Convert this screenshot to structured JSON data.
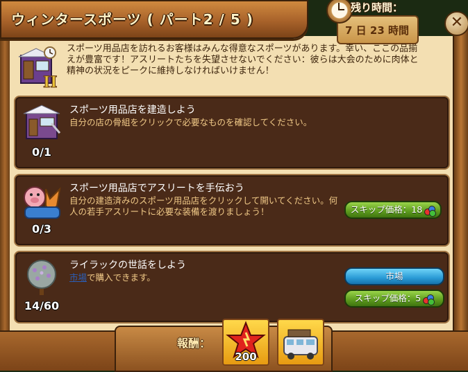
{
  "window": {
    "title": "ウィンタースポーツ ( パート2 / 5 )",
    "timer_label": "残り時間：",
    "timer_value": "7 日 23 時間",
    "close_symbol": "✕"
  },
  "intro": {
    "icon": "sports-shop-part2-icon",
    "text": "スポーツ用品店を訪れるお客様はみんな得意なスポーツがあります。幸い、ここの品揃えが豊富です！アスリートたちを失望させないでください：彼らは大会のために肉体と精神の状況をピークに維持しなければいけません！"
  },
  "tasks": [
    {
      "title": "スポーツ用品店を建造しよう",
      "description": "自分の店の骨組をクリックで必要なものを確認してください。",
      "progress": "0/1",
      "icon": "sports-shop-icon"
    },
    {
      "title": "スポーツ用品店でアスリートを手伝おう",
      "description": "自分の建造済みのスポーツ用品店をクリックして開いてください。何人の若手アスリートに必要な装備を渡りましょう！",
      "progress": "0/3",
      "icon": "athletes-icon",
      "skip_button": "スキップ価格：18"
    },
    {
      "title": "ライラックの世話をしよう",
      "description_link": "市場",
      "description_rest": "で購入できます。",
      "progress": "14/60",
      "icon": "lilac-bush-icon",
      "market_button": "市場",
      "skip_button": "スキップ価格：5"
    }
  ],
  "rewards": {
    "label": "報酬：",
    "items": [
      {
        "icon": "experience-star-icon",
        "value": "200"
      },
      {
        "icon": "camper-van-icon",
        "value": ""
      }
    ]
  },
  "colors": {
    "panel_bg": "#f3dfb2",
    "task_bg": "#4a2a18",
    "task_title": "#ffffff",
    "task_desc": "#f0c987",
    "button_green": "#5c9a1d",
    "button_blue": "#2a9bd6"
  }
}
